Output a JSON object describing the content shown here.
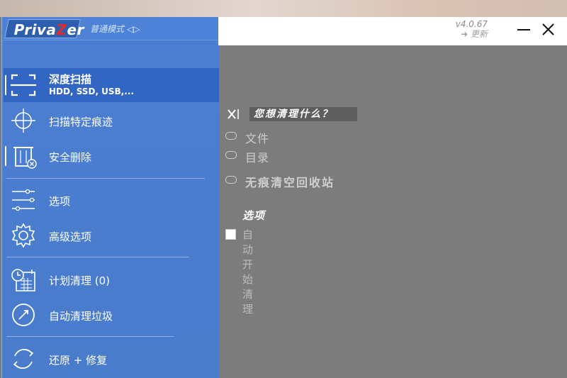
{
  "app": {
    "logo_part1": "Priva",
    "logo_z": "Z",
    "logo_part2": "er",
    "mode": "普通模式",
    "mode_arrows": "◁▷",
    "version": "v4.0.67",
    "update": "➜ 更新"
  },
  "sidebar": {
    "items": [
      {
        "label": "深度扫描",
        "sublabel": "HDD, SSD, USB,...",
        "icon": "scan-frame-icon"
      },
      {
        "label": "扫描特定痕迹",
        "icon": "crosshair-icon"
      },
      {
        "label": "安全删除",
        "icon": "trash-delete-icon"
      },
      {
        "label": "选项",
        "icon": "sliders-icon"
      },
      {
        "label": "高级选项",
        "icon": "gear-icon"
      },
      {
        "label": "计划清理 (0)",
        "icon": "calendar-clock-icon"
      },
      {
        "label": "自动清理垃圾",
        "icon": "gauge-icon"
      },
      {
        "label": "还原 + 修复",
        "icon": "restore-icon"
      }
    ]
  },
  "main": {
    "question": "您想清理什么？",
    "options": [
      "文件",
      "目录",
      "无痕清空回收站"
    ],
    "section_title": "选项",
    "auto_clean": "自动开始清理"
  },
  "colors": {
    "sidebar_bg": "#4a7ccc",
    "active_bg": "#3366c2",
    "content_bg": "#7c7c7c",
    "logo_z": "#e32b2b"
  }
}
